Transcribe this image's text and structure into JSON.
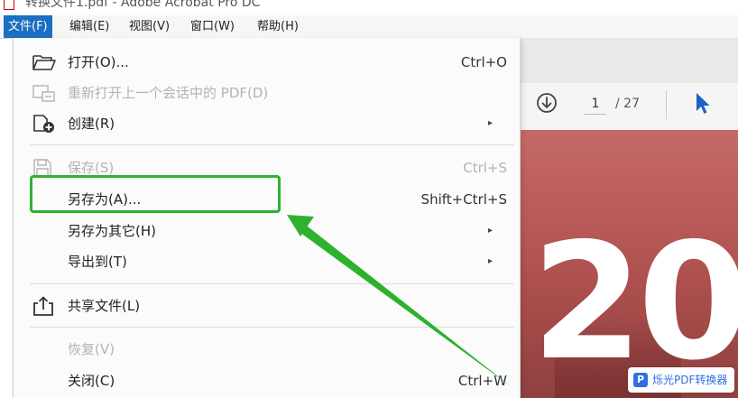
{
  "window": {
    "title": "转换文件1.pdf - Adobe Acrobat Pro DC"
  },
  "menubar": {
    "items": [
      {
        "label": "文件(F)",
        "active": true
      },
      {
        "label": "编辑(E)"
      },
      {
        "label": "视图(V)"
      },
      {
        "label": "窗口(W)"
      },
      {
        "label": "帮助(H)"
      }
    ]
  },
  "file_menu": {
    "open": {
      "label": "打开(O)...",
      "shortcut": "Ctrl+O",
      "icon": "folder-open-icon"
    },
    "reopen": {
      "label": "重新打开上一个会话中的 PDF(D)",
      "icon": "reopen-session-icon",
      "disabled": true
    },
    "create": {
      "label": "创建(R)",
      "submenu_arrow": "▸",
      "icon": "create-pdf-icon"
    },
    "save": {
      "label": "保存(S)",
      "shortcut": "Ctrl+S",
      "icon": "save-icon",
      "disabled": true
    },
    "save_as": {
      "label": "另存为(A)...",
      "shortcut": "Shift+Ctrl+S"
    },
    "save_as_other": {
      "label": "另存为其它(H)",
      "submenu_arrow": "▸"
    },
    "export_to": {
      "label": "导出到(T)",
      "submenu_arrow": "▸"
    },
    "share": {
      "label": "共享文件(L)",
      "icon": "share-icon"
    },
    "revert": {
      "label": "恢复(V)",
      "disabled": true
    },
    "close": {
      "label": "关闭(C)",
      "shortcut": "Ctrl+W"
    }
  },
  "page_nav": {
    "current_page": "1",
    "total_pages": "/ 27"
  },
  "document": {
    "cover_text": "20"
  },
  "watermark": {
    "logo": "P",
    "text": "烁光PDF转换器"
  },
  "colors": {
    "menu_active": "#1a6fc2",
    "annotation_green": "#2fb12f",
    "cursor_blue": "#1c63c7",
    "cover_red": "#b85a57"
  }
}
